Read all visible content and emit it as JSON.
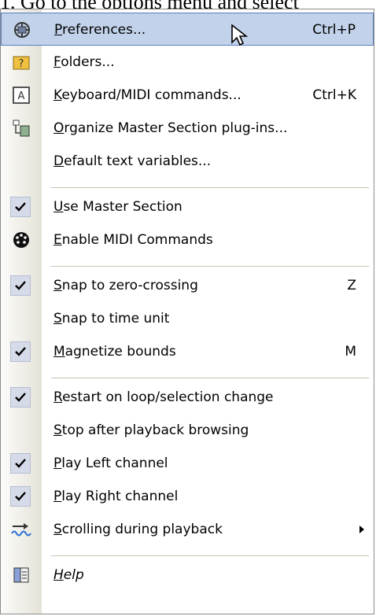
{
  "caption": "1. Go to the options menu and select",
  "menu": {
    "items": [
      {
        "label": "Preferences...",
        "shortcut": "Ctrl+P",
        "icon": "preferences-icon"
      },
      {
        "label": "Folders...",
        "icon": "folders-icon"
      },
      {
        "label": "Keyboard/MIDI commands...",
        "shortcut": "Ctrl+K",
        "icon": "keyboard-icon"
      },
      {
        "label": "Organize Master Section plug-ins...",
        "icon": "plugins-icon"
      },
      {
        "label": "Default text variables..."
      },
      {
        "label": "Use Master Section",
        "checked": true
      },
      {
        "label": "Enable MIDI Commands",
        "icon": "midi-icon"
      },
      {
        "label": "Snap to zero-crossing",
        "shortcut": "Z",
        "checked": true
      },
      {
        "label": "Snap to time unit"
      },
      {
        "label": "Magnetize bounds",
        "shortcut": "M",
        "checked": true
      },
      {
        "label": "Restart on loop/selection change",
        "checked": true
      },
      {
        "label": "Stop after playback browsing"
      },
      {
        "label": "Play Left channel",
        "checked": true
      },
      {
        "label": "Play Right channel",
        "checked": true
      },
      {
        "label": "Scrolling during playback",
        "icon": "scrolling-icon",
        "submenu": true
      },
      {
        "label": "Help",
        "icon": "help-book-icon"
      }
    ]
  },
  "colors": {
    "highlight": "#c2d2ea",
    "highlight_border": "#5a7dbd",
    "gutter": "#e5e3d8"
  }
}
